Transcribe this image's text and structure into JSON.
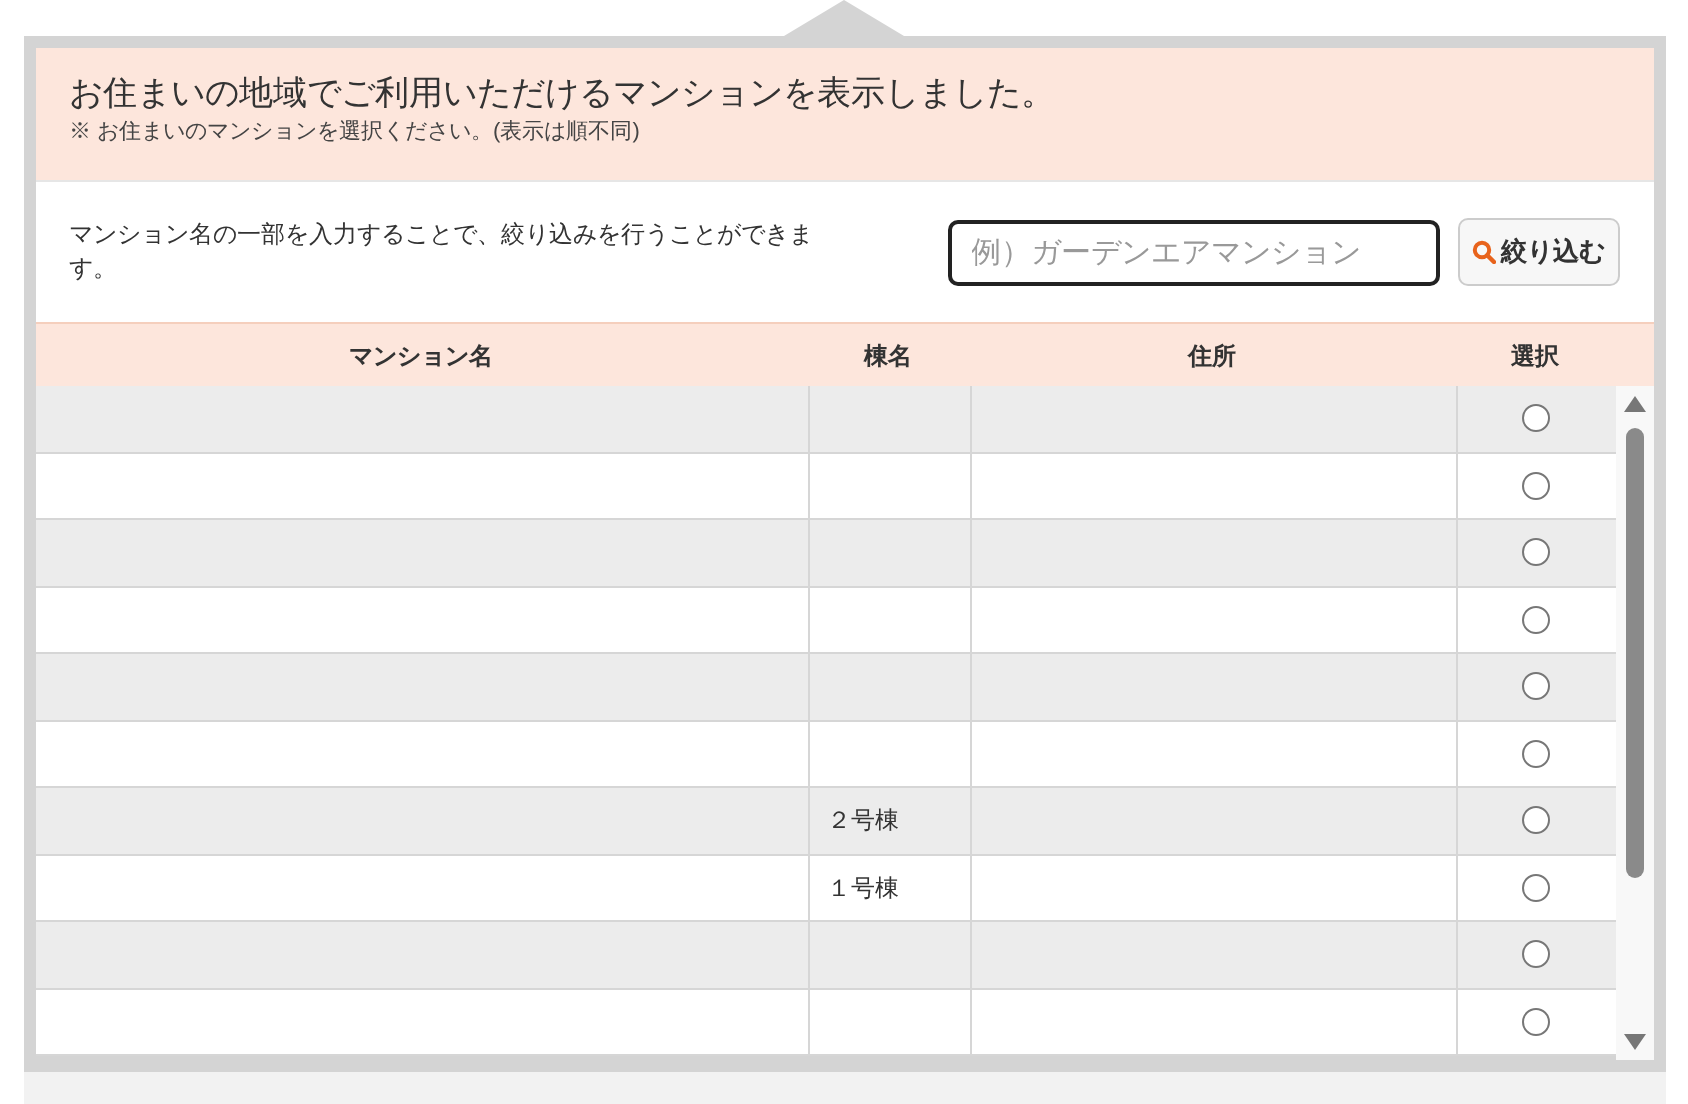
{
  "notice": {
    "title": "お住まいの地域でご利用いただけるマンションを表示しました。",
    "note": "※ お住まいのマンションを選択ください。(表示は順不同)"
  },
  "filter": {
    "description": "マンション名の一部を入力することで、絞り込みを行うことができます。",
    "search": {
      "placeholder": "例）ガーデンエアマンション"
    },
    "button": "絞り込む"
  },
  "table": {
    "columns": [
      "マンション名",
      "棟名",
      "住所",
      "選択"
    ],
    "rows": [
      {
        "selected": false
      },
      {
        "selected": false
      },
      {
        "selected": false
      },
      {
        "selected": false
      },
      {
        "selected": false
      },
      {
        "selected": false
      },
      {
        "building": "２号棟",
        "selected": false
      },
      {
        "building": "１号棟",
        "selected": false
      },
      {
        "selected": false
      },
      {
        "selected": false
      }
    ]
  }
}
